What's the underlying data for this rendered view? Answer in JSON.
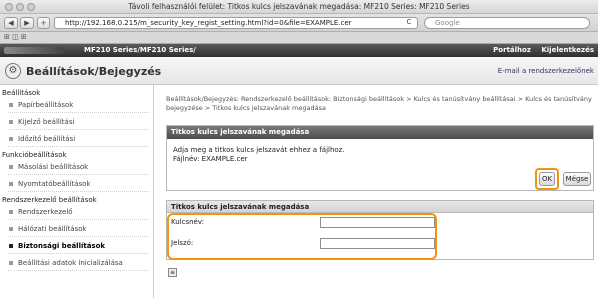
{
  "browser": {
    "window_title": "Távoli felhasználói felület: Titkos kulcs jelszavának megadása: MF210 Series: MF210 Series",
    "url": "http://192.168.0.215/m_security_key_regist_setting.html?id=0&file=EXAMPLE.cer",
    "search_placeholder": "Google",
    "back_label": "◀",
    "forward_label": "▶",
    "add_label": "+",
    "reload_label": "C",
    "bookmarks_label": "⊞ ◫ ⊞"
  },
  "header": {
    "product": "MF210 Series/MF210 Series/",
    "portal_link": "Portálhoz",
    "logout_link": "Kijelentkezés",
    "page_title": "Beállítások/Bejegyzés",
    "email_link": "E-mail a rendszerkezelőnek"
  },
  "sidebar": {
    "sections": [
      {
        "heading": "Beállítások",
        "items": [
          {
            "label": "Papírbeállítások",
            "active": false
          },
          {
            "label": "Kijelző beállítási",
            "active": false
          },
          {
            "label": "Időzítő beállítási",
            "active": false
          }
        ]
      },
      {
        "heading": "Funkcióbeállítások",
        "items": [
          {
            "label": "Másolási beállítások",
            "active": false
          },
          {
            "label": "Nyomtatóbeállítások",
            "active": false
          }
        ]
      },
      {
        "heading": "Rendszerkezelő beállítások",
        "items": [
          {
            "label": "Rendszerkezelő",
            "active": false
          },
          {
            "label": "Hálózati beállítások",
            "active": false
          },
          {
            "label": "Biztonsági beállítások",
            "active": true
          },
          {
            "label": "Beállítási adatok inicializálása",
            "active": false
          }
        ]
      }
    ]
  },
  "main": {
    "breadcrumb": "Beállítások/Bejegyzés: Rendszerkezelő beállítások: Biztonsági beállítások > Kulcs és tanúsítvány beállításai > Kulcs és tanúsítvány bejegyzése > Titkos kulcs jelszavának megadása",
    "panel1": {
      "title": "Titkos kulcs jelszavának megadása",
      "message_line1": "Adja meg a titkos kulcs jelszavát ehhez a fájlhoz.",
      "message_line2": "Fájlnév: EXAMPLE.cer",
      "ok_label": "OK",
      "cancel_label": "Mégse"
    },
    "panel2": {
      "title": "Titkos kulcs jelszavának megadása",
      "key_name_label": "Kulcsnév:",
      "key_name_value": "",
      "password_label": "Jelszó:",
      "password_value": ""
    }
  },
  "colors": {
    "highlight": "#f0960e",
    "header_bg": "#3a3a3a"
  }
}
